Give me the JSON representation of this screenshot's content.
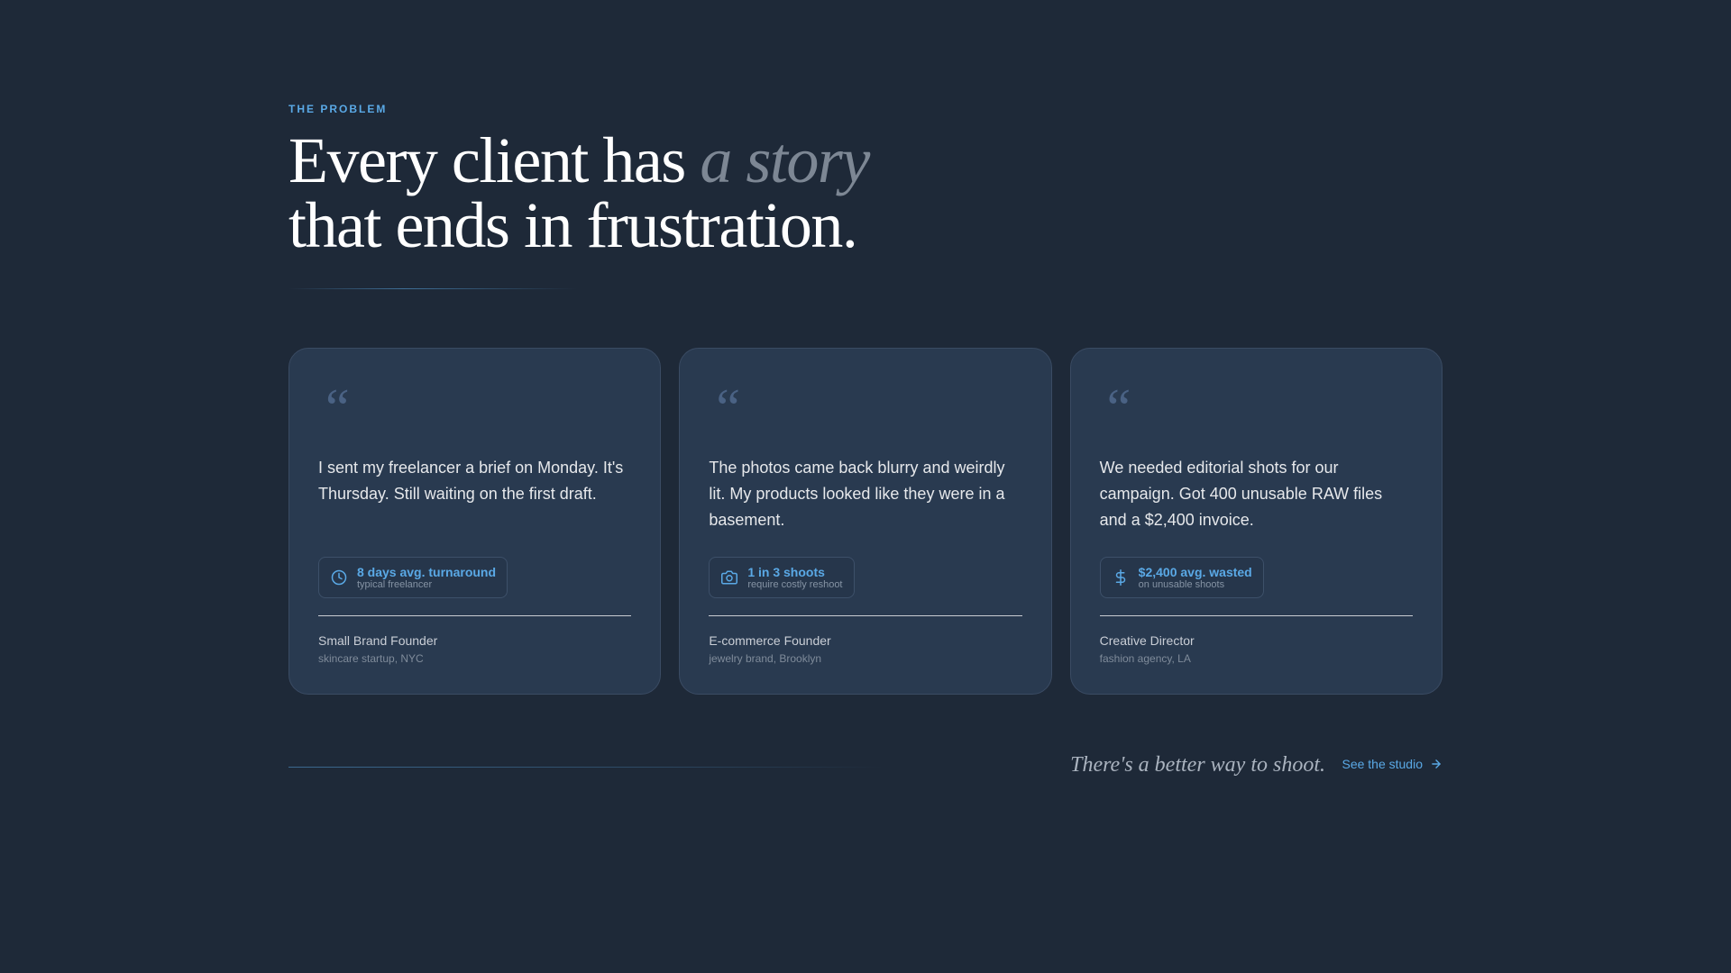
{
  "section": {
    "eyebrow": "THE PROBLEM",
    "headline_part1": "Every client has ",
    "headline_accent": "a story",
    "headline_line2": "that ends in frustration."
  },
  "cards": [
    {
      "quote_mark": "“",
      "text": "I sent my freelancer a brief on Monday. It's Thursday. Still waiting on the first draft.",
      "stat_icon": "clock-icon",
      "stat_main": "8 days avg. turnaround",
      "stat_sub": "typical freelancer",
      "role": "Small Brand Founder",
      "role_sub": "skincare startup, NYC"
    },
    {
      "quote_mark": "“",
      "text": "The photos came back blurry and weirdly lit. My products looked like they were in a basement.",
      "stat_icon": "camera-icon",
      "stat_main": "1 in 3 shoots",
      "stat_sub": "require costly reshoot",
      "role": "E-commerce Founder",
      "role_sub": "jewelry brand, Brooklyn"
    },
    {
      "quote_mark": "“",
      "text": "We needed editorial shots for our campaign. Got 400 unusable RAW files and a $2,400 invoice.",
      "stat_icon": "dollar-icon",
      "stat_main": "$2,400 avg. wasted",
      "stat_sub": "on unusable shoots",
      "role": "Creative Director",
      "role_sub": "fashion agency, LA"
    }
  ],
  "footer": {
    "tagline": "There's a better way to shoot.",
    "cta_label": "See the studio",
    "cta_icon": "arrow-right-icon"
  },
  "colors": {
    "background": "#1e2938",
    "card": "#293a50",
    "accent": "#5aa9e6"
  }
}
